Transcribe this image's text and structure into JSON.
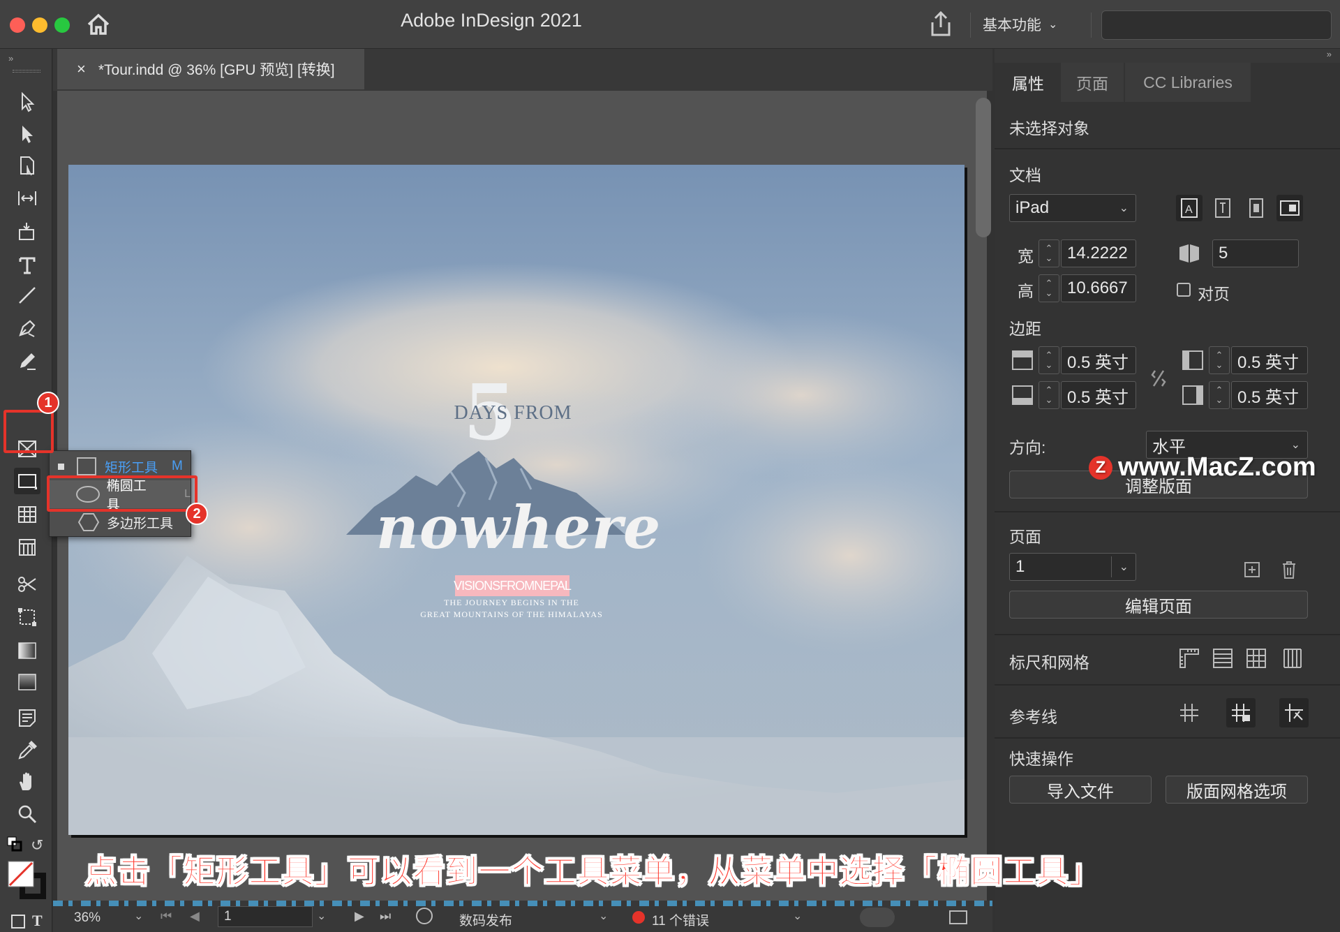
{
  "titlebar": {
    "app_title": "Adobe InDesign 2021",
    "workspace": "基本功能"
  },
  "document_tab": {
    "close": "×",
    "title": "*Tour.indd @ 36% [GPU 预览] [转换]"
  },
  "poster": {
    "days_from": "DAYS FROM",
    "number": "5",
    "headline": "nowhere",
    "banner": "VISIONSFROMNEPAL",
    "tagline_1": "THE JOURNEY BEGINS IN THE",
    "tagline_2": "GREAT MOUNTAINS OF THE HIMALAYAS"
  },
  "flyout": {
    "items": [
      {
        "label": "矩形工具",
        "shortcut": "M",
        "selected": true
      },
      {
        "label": "椭圆工具",
        "shortcut": "L"
      },
      {
        "label": "多边形工具",
        "shortcut": ""
      }
    ]
  },
  "callouts": {
    "one": "1",
    "two": "2"
  },
  "right_panel": {
    "tabs": [
      "属性",
      "页面",
      "CC Libraries"
    ],
    "no_selection": "未选择对象",
    "document_heading": "文档",
    "preset": "iPad",
    "width_label": "宽",
    "width_value": "14.2222",
    "height_label": "高",
    "height_value": "10.6667",
    "pages_value": "5",
    "facing_pages": "对页",
    "margins_heading": "边距",
    "margin_top": "0.5 英寸",
    "margin_bottom": "0.5 英寸",
    "margin_left": "0.5 英寸",
    "margin_right": "0.5 英寸",
    "orientation_label": "方向:",
    "orientation_value": "水平",
    "adjust_layout": "调整版面",
    "pages_heading": "页面",
    "page_select": "1",
    "edit_page": "编辑页面",
    "rulers_heading": "标尺和网格",
    "guides_heading": "参考线",
    "quick_actions_heading": "快速操作",
    "import_file": "导入文件",
    "layout_grid_options": "版面网格选项"
  },
  "statusbar": {
    "zoom": "36%",
    "page": "1",
    "preflight_profile": "数码发布",
    "errors": "11 个错误"
  },
  "caption": "点击「矩形工具」可以看到一个工具菜单，从菜单中选择「椭圆工具」",
  "watermark": "www.MacZ.com",
  "colors": {
    "accent_red": "#e5332a",
    "selected_blue": "#4a9ff5",
    "banner_pink": "#f7b8be"
  }
}
